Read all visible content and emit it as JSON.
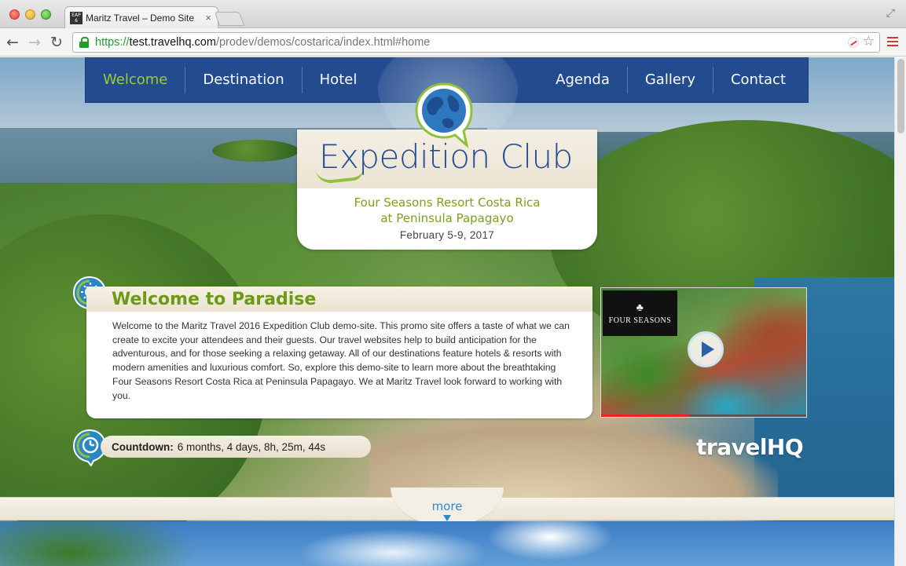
{
  "browser": {
    "tab_title": "Maritz Travel – Demo Site",
    "tab_favicon_text": "EAP 6",
    "url_scheme": "https://",
    "url_host": "test.travelhq.com",
    "url_path": "/prodev/demos/costarica/index.html#home"
  },
  "nav": {
    "left": [
      "Welcome",
      "Destination",
      "Hotel"
    ],
    "right": [
      "Agenda",
      "Gallery",
      "Contact"
    ],
    "active": "Welcome",
    "active_color": "#9acd32",
    "bar_color": "#234b8f"
  },
  "logo": {
    "title": "Expedition Club",
    "line1": "Four Seasons Resort Costa Rica",
    "line2": "at Peninsula Papagayo",
    "dates": "February 5-9, 2017"
  },
  "welcome": {
    "title": "Welcome to Paradise",
    "body": "Welcome to the Maritz Travel 2016 Expedition Club demo-site. This promo site offers a taste of what we can create to excite your attendees and their guests. Our travel websites help to build anticipation for the adventurous, and for those seeking a relaxing getaway. All of our destinations feature hotels & resorts with modern amenities and luxurious comfort. So, explore this demo-site to learn more about the breathtaking Four Seasons Resort Costa Rica at Peninsula Papagayo. We at Maritz Travel look forward to working with you."
  },
  "video": {
    "brand": "Four Seasons",
    "progress_fraction": 0.43
  },
  "countdown": {
    "label": "Countdown:",
    "value": "6 months, 4 days, 8h, 25m, 44s"
  },
  "brand_logo": "travelHQ",
  "more": "more",
  "icons": {
    "welcome_badge": "sun-icon",
    "countdown_badge": "clock-icon",
    "logo": "globe-icon"
  }
}
